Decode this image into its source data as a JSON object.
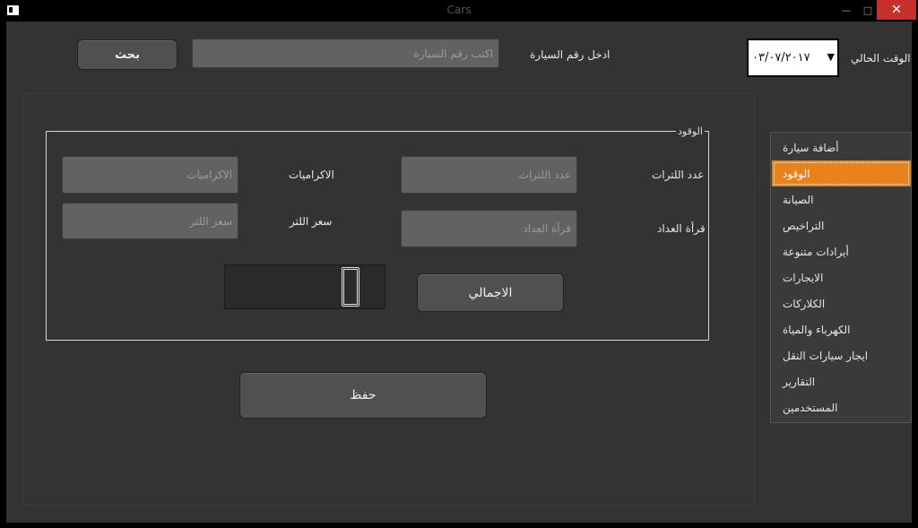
{
  "window": {
    "title": "Cars"
  },
  "search": {
    "button_label": "بحث",
    "input_placeholder": "اكتب رقم السيارة",
    "input_label": "ادخل رقم السيارة"
  },
  "current_time": {
    "label": "الوقت الحالي",
    "date_value": "٠٣/٠٧/٢٠١٧"
  },
  "arrival_group": {
    "title": "الوقود",
    "liters_label": "عدد اللترات",
    "liters_placeholder": "عدد اللترات",
    "tips_label": "الاكراميات",
    "tips_placeholder": "الاكراميات",
    "meter_label": "قرأة العداد",
    "meter_placeholder": "قرأة العداد",
    "price_label": "سعر اللتر",
    "price_placeholder": "سعر اللتر",
    "total_button": "الاجمالي"
  },
  "save_button": "حفظ",
  "sidebar": {
    "items": [
      {
        "label": "أضافة سيارة",
        "active": false
      },
      {
        "label": "الوقود",
        "active": true
      },
      {
        "label": "الصيانة",
        "active": false
      },
      {
        "label": "التراخيص",
        "active": false
      },
      {
        "label": "أيرادات متنوعة",
        "active": false
      },
      {
        "label": "الايجارات",
        "active": false
      },
      {
        "label": "الكلاركات",
        "active": false
      },
      {
        "label": "الكهرباء والمياة",
        "active": false
      },
      {
        "label": "ايجار سيارات النقل",
        "active": false
      },
      {
        "label": "التقارير",
        "active": false
      },
      {
        "label": "المستخدمين",
        "active": false
      }
    ]
  },
  "colors": {
    "accent": "#e8821e",
    "background": "#333333",
    "close_button": "#c7312b"
  }
}
